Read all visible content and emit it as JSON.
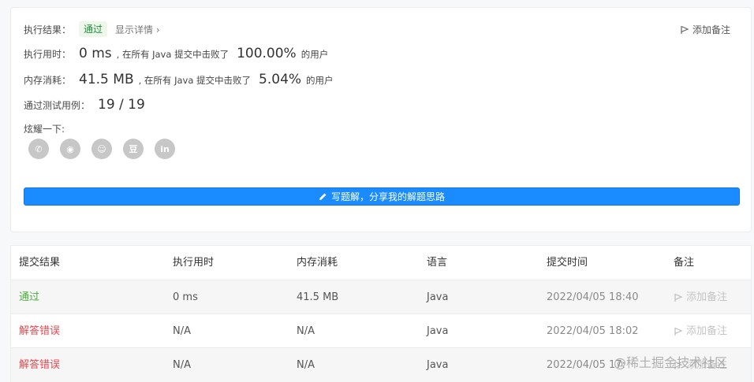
{
  "result": {
    "label": "执行结果：",
    "status": "通过",
    "details_link": "显示详情 ›",
    "add_note": "添加备注"
  },
  "runtime": {
    "label": "执行用时：",
    "value": "0 ms",
    "middle": ", 在所有 Java 提交中击败了",
    "percent": "100.00%",
    "suffix": "的用户"
  },
  "memory": {
    "label": "内存消耗：",
    "value": "41.5 MB",
    "middle": ", 在所有 Java 提交中击败了",
    "percent": "5.04%",
    "suffix": "的用户"
  },
  "testcases": {
    "label": "通过测试用例：",
    "value": "19 / 19"
  },
  "share": {
    "label": "炫耀一下:",
    "icons": [
      {
        "name": "wechat-icon",
        "glyph": "✆"
      },
      {
        "name": "weibo-icon",
        "glyph": "◉"
      },
      {
        "name": "qq-icon",
        "glyph": "☺"
      },
      {
        "name": "douban-icon",
        "glyph": "豆"
      },
      {
        "name": "linkedin-icon",
        "glyph": "in"
      }
    ]
  },
  "write_solution": "写题解，分享我的解题思路",
  "table": {
    "headers": [
      "提交结果",
      "执行用时",
      "内存消耗",
      "语言",
      "提交时间",
      "备注"
    ],
    "rows": [
      {
        "status": "通过",
        "status_type": "ok",
        "runtime": "0 ms",
        "memory": "41.5 MB",
        "lang": "Java",
        "time": "2022/04/05 18:40",
        "note": "添加备注"
      },
      {
        "status": "解答错误",
        "status_type": "err",
        "runtime": "N/A",
        "memory": "N/A",
        "lang": "Java",
        "time": "2022/04/05 18:02",
        "note": "添加备注"
      },
      {
        "status": "解答错误",
        "status_type": "err",
        "runtime": "N/A",
        "memory": "N/A",
        "lang": "Java",
        "time": "2022/04/05 17:",
        "note": "添加备注"
      }
    ]
  },
  "watermark": "@稀土掘金技术社区",
  "colors": {
    "accent": "#1a8cff",
    "success": "#4caf3a",
    "error": "#e5484d"
  }
}
